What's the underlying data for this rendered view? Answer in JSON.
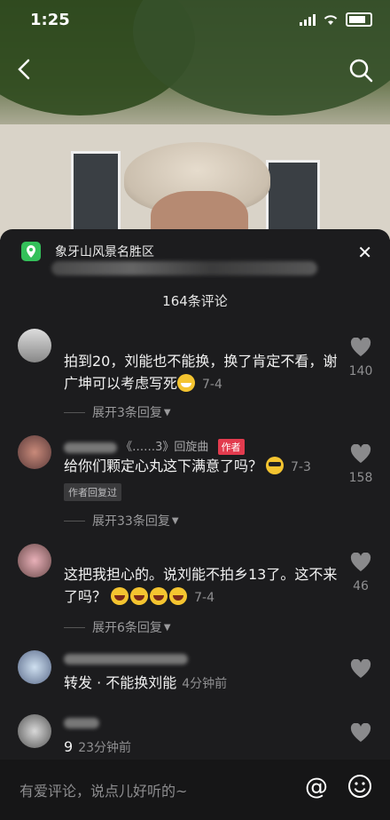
{
  "status": {
    "time": "1:25"
  },
  "location": {
    "title": "象牙山风景名胜区"
  },
  "comments_count": "164条评论",
  "comments": [
    {
      "text": "拍到20，刘能也不能换，换了肯定不看，谢广坤可以考虑写死",
      "time": "7-4",
      "replies": "展开3条回复",
      "likes": "140"
    },
    {
      "name": "《……3》回旋曲",
      "author_tag": "作者",
      "text": "给你们颗定心丸这下满意了吗？",
      "time": "7-3",
      "reply_tag": "作者回复过",
      "replies": "展开33条回复",
      "likes": "158"
    },
    {
      "text": "这把我担心的。说刘能不拍乡13了。这不来了吗？",
      "time": "7-4",
      "replies": "展开6条回复",
      "likes": "46"
    },
    {
      "text": "转发 · 不能换刘能",
      "time": "4分钟前"
    },
    {
      "text": "9",
      "time": "23分钟前"
    }
  ],
  "input": {
    "placeholder": "有爱评论，说点儿好听的~"
  },
  "icons": {
    "back": "back-arrow-icon",
    "search": "search-icon",
    "location": "location-pin-icon",
    "close": "close-icon",
    "heart": "heart-icon",
    "at": "at-icon",
    "emoji": "emoji-icon"
  },
  "colors": {
    "accent_green": "#34c05a",
    "author_red": "#e23b4e",
    "panel": "#1c1c1e"
  }
}
